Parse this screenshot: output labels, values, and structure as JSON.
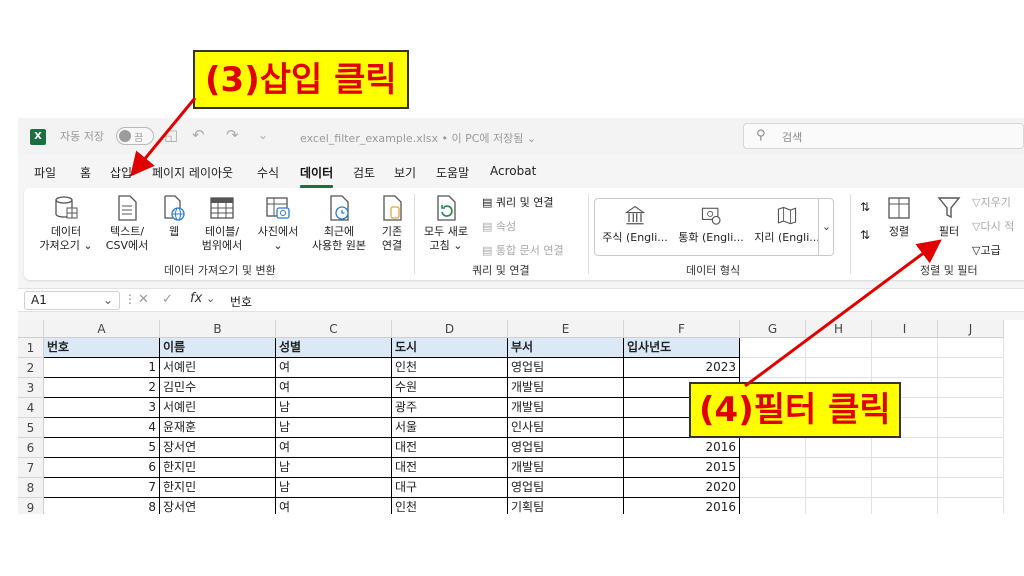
{
  "titlebar": {
    "app_icon": "X",
    "autosave_label": "자동 저장",
    "autosave_toggle": "끔",
    "filename": "excel_filter_example.xlsx",
    "location": "• 이 PC에 저장됨 ⌄",
    "search_placeholder": "검색",
    "icons": [
      "excel-logo-icon",
      "save-icon",
      "undo-icon",
      "redo-icon",
      "search-icon"
    ]
  },
  "menu": {
    "tabs": [
      "파일",
      "홈",
      "삽입",
      "페이지 레이아웃",
      "수식",
      "데이터",
      "검토",
      "보기",
      "도움말",
      "Acrobat"
    ],
    "active_tab": "데이터"
  },
  "ribbon": {
    "get_data": {
      "buttons": [
        {
          "line1": "데이터",
          "line2": "가져오기 ⌄"
        },
        {
          "line1": "텍스트/",
          "line2": "CSV에서"
        },
        {
          "line1": "웹",
          "line2": ""
        },
        {
          "line1": "테이블/",
          "line2": "범위에서"
        },
        {
          "line1": "사진에서",
          "line2": "⌄"
        },
        {
          "line1": "최근에",
          "line2": "사용한 원본"
        },
        {
          "line1": "기존",
          "line2": "연결"
        }
      ],
      "label": "데이터 가져오기 및 변환"
    },
    "queries": {
      "refresh_line1": "모두 새로",
      "refresh_line2": "고침 ⌄",
      "items": [
        "쿼리 및 연결",
        "속성",
        "통합 문서 연결"
      ],
      "label": "쿼리 및 연결"
    },
    "data_types": {
      "items": [
        "주식 (Engli...",
        "통화 (Engli...",
        "지리 (Engli..."
      ],
      "label": "데이터 형식"
    },
    "sort_filter": {
      "sort": "정렬",
      "filter": "필터",
      "small": [
        "지우기",
        "다시 적",
        "고급"
      ],
      "label": "정렬 및 필터"
    }
  },
  "formula_bar": {
    "name_box": "A1",
    "value": "번호"
  },
  "sheet": {
    "columns": [
      "A",
      "B",
      "C",
      "D",
      "E",
      "F",
      "G",
      "H",
      "I",
      "J"
    ],
    "rows": [
      "1",
      "2",
      "3",
      "4",
      "5",
      "6",
      "7",
      "8",
      "9"
    ],
    "header": [
      "번호",
      "이름",
      "성별",
      "도시",
      "부서",
      "입사년도"
    ],
    "data": [
      [
        "1",
        "서예린",
        "여",
        "인천",
        "영업팀",
        "2023"
      ],
      [
        "2",
        "김민수",
        "여",
        "수원",
        "개발팀",
        ""
      ],
      [
        "3",
        "서예린",
        "남",
        "광주",
        "개발팀",
        ""
      ],
      [
        "4",
        "윤재훈",
        "남",
        "서울",
        "인사팀",
        ""
      ],
      [
        "5",
        "장서연",
        "여",
        "대전",
        "영업팀",
        "2016"
      ],
      [
        "6",
        "한지민",
        "남",
        "대전",
        "개발팀",
        "2015"
      ],
      [
        "7",
        "한지민",
        "남",
        "대구",
        "영업팀",
        "2020"
      ],
      [
        "8",
        "장서연",
        "여",
        "인천",
        "기획팀",
        "2016"
      ]
    ]
  },
  "annotations": {
    "step3": "(3)삽입 클릭",
    "step4": "(4)필터 클릭",
    "arrow_color": "#e00000"
  }
}
